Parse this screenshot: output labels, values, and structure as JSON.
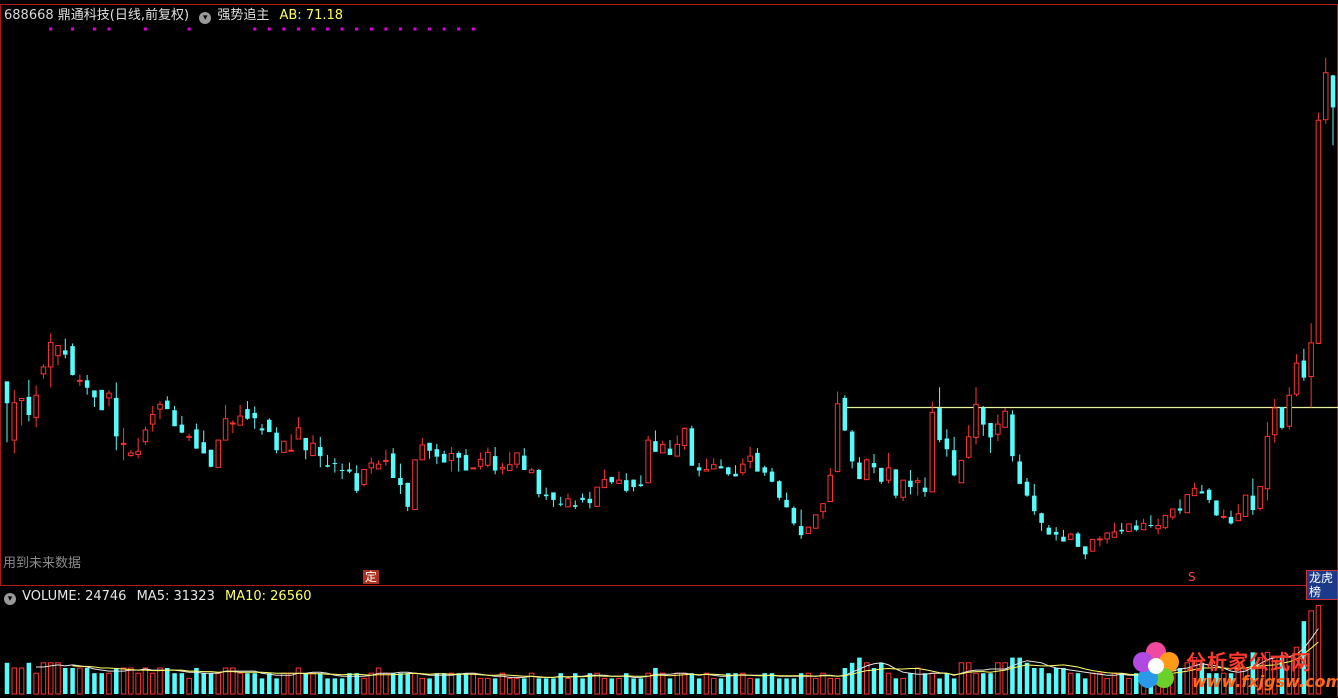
{
  "header": {
    "code": "688668",
    "name_line": "鼎通科技(日线,前复权)",
    "indicator": "强势追主",
    "ab_text": "AB: 71.18"
  },
  "volume_header": {
    "volume_text": "VOLUME: 24746",
    "ma5_text": "MA5: 31323",
    "ma10_text": "MA10: 26560"
  },
  "note": "用到未来数据",
  "tags": {
    "ding": "定",
    "s": "S",
    "lhb": "龙虎榜"
  },
  "watermark": {
    "cn": "分析家公式网",
    "url": "www.fxjgsw.com"
  },
  "colors": {
    "up": "#ff3232",
    "down": "#54fcfc",
    "signal": "#e000e0",
    "level_line": "#e8f0a0",
    "ma5": "#e6e6e6",
    "ma10": "#ffff66",
    "separator": "#b01818"
  },
  "chart_data": [
    {
      "type": "candlestick",
      "level_line_value": 67.3,
      "candles": [
        [
          72.2,
          68.1,
          72.2,
          60.8
        ],
        [
          61.2,
          68.2,
          70.6,
          58.7
        ],
        [
          68.6,
          69.0,
          69.1,
          63.9
        ],
        [
          69.3,
          65.9,
          72.5,
          64.7
        ],
        [
          65.4,
          69.6,
          71.4,
          63.6
        ],
        [
          73.6,
          74.9,
          75.4,
          72.7
        ],
        [
          74.9,
          79.5,
          81.2,
          71.1
        ],
        [
          77.0,
          78.9,
          78.6,
          75.2
        ],
        [
          78.0,
          77.2,
          80.2,
          76.5
        ],
        [
          78.8,
          73.4,
          79.3,
          73.3
        ],
        [
          72.3,
          72.4,
          73.5,
          71.3
        ],
        [
          72.4,
          71.0,
          73.4,
          69.7
        ],
        [
          70.5,
          69.2,
          70.1,
          67.4
        ],
        [
          70.6,
          66.8,
          70.2,
          68.2
        ],
        [
          69.1,
          70.0,
          70.5,
          67.5
        ],
        [
          69.1,
          61.9,
          72.0,
          59.3
        ],
        [
          60.4,
          60.6,
          63.5,
          57.4
        ],
        [
          58.3,
          58.8,
          59.3,
          58.1
        ],
        [
          58.5,
          59.1,
          61.6,
          57.8
        ],
        [
          60.9,
          63.1,
          63.7,
          60.3
        ],
        [
          64.2,
          66.0,
          67.6,
          62.8
        ],
        [
          67.0,
          67.9,
          68.5,
          65.1
        ],
        [
          68.6,
          67.0,
          69.4,
          67.0
        ],
        [
          66.8,
          63.8,
          67.6,
          65.2
        ],
        [
          64.1,
          62.6,
          65.7,
          62.5
        ],
        [
          61.8,
          61.9,
          62.4,
          61.0
        ],
        [
          63.2,
          59.6,
          64.3,
          60.6
        ],
        [
          60.8,
          58.7,
          63.0,
          59.6
        ],
        [
          59.4,
          56.2,
          58.4,
          56.1
        ],
        [
          56.1,
          61.2,
          60.4,
          56.1
        ],
        [
          61.2,
          65.2,
          67.8,
          61.3
        ],
        [
          64.3,
          64.4,
          64.9,
          62.5
        ],
        [
          64.0,
          65.7,
          67.8,
          65.2
        ],
        [
          67.0,
          65.2,
          68.5,
          65.0
        ],
        [
          66.3,
          65.3,
          67.5,
          63.3
        ],
        [
          63.4,
          63.0,
          64.2,
          62.2
        ],
        [
          65.0,
          62.7,
          65.3,
          62.9
        ],
        [
          62.6,
          59.3,
          63.6,
          58.7
        ],
        [
          58.9,
          61.0,
          60.5,
          59.1
        ],
        [
          59.2,
          59.3,
          62.3,
          59.2
        ],
        [
          61.4,
          63.5,
          65.5,
          61.8
        ],
        [
          61.6,
          59.3,
          61.3,
          57.6
        ],
        [
          58.3,
          60.6,
          62.1,
          58.3
        ],
        [
          59.9,
          58.2,
          61.8,
          56.1
        ],
        [
          56.5,
          56.2,
          58.4,
          56.1
        ],
        [
          56.9,
          56.8,
          57.8,
          55.1
        ],
        [
          55.6,
          55.5,
          56.8,
          53.9
        ],
        [
          55.7,
          55.3,
          57.0,
          55.0
        ],
        [
          55.0,
          51.7,
          56.5,
          51.3
        ],
        [
          52.9,
          55.7,
          55.1,
          52.5
        ],
        [
          56.0,
          56.9,
          57.9,
          54.9
        ],
        [
          55.8,
          56.7,
          57.4,
          55.7
        ],
        [
          57.4,
          57.4,
          59.4,
          56.4
        ],
        [
          58.7,
          54.1,
          59.7,
          54.7
        ],
        [
          54.1,
          52.8,
          56.8,
          51.1
        ],
        [
          53.2,
          48.7,
          52.3,
          47.9
        ],
        [
          48.2,
          57.5,
          56.5,
          50.5
        ],
        [
          57.5,
          60.3,
          61.6,
          57.5
        ],
        [
          60.7,
          59.2,
          60.3,
          57.7
        ],
        [
          59.5,
          58.1,
          60.5,
          56.7
        ],
        [
          58.6,
          57.0,
          59.2,
          57.7
        ],
        [
          57.4,
          58.7,
          59.9,
          55.3
        ],
        [
          58.8,
          57.9,
          59.1,
          55.3
        ],
        [
          58.4,
          55.5,
          59.5,
          55.7
        ],
        [
          56.0,
          56.0,
          56.0,
          56.0
        ],
        [
          56.3,
          57.6,
          58.9,
          55.7
        ],
        [
          56.5,
          58.9,
          59.8,
          56.1
        ],
        [
          58.2,
          55.5,
          59.9,
          54.8
        ],
        [
          55.8,
          56.1,
          56.9,
          54.8
        ],
        [
          55.5,
          56.6,
          59.0,
          55.6
        ],
        [
          56.7,
          58.8,
          57.7,
          55.9
        ],
        [
          58.3,
          55.6,
          59.7,
          55.6
        ],
        [
          55.1,
          55.6,
          56.0,
          55.4
        ],
        [
          55.6,
          51.1,
          55.8,
          50.5
        ],
        [
          51.0,
          50.7,
          52.3,
          50.0
        ],
        [
          51.4,
          50.0,
          51.1,
          48.7
        ],
        [
          49.3,
          49.1,
          50.6,
          48.8
        ],
        [
          48.7,
          50.2,
          51.2,
          48.7
        ],
        [
          49.0,
          48.7,
          49.9,
          48.3
        ],
        [
          50.4,
          50.0,
          51.2,
          49.5
        ],
        [
          50.2,
          49.4,
          51.5,
          48.4
        ],
        [
          48.8,
          52.4,
          52.3,
          48.7
        ],
        [
          52.3,
          53.8,
          55.7,
          52.4
        ],
        [
          54.3,
          53.3,
          54.1,
          53.0
        ],
        [
          53.1,
          53.7,
          55.3,
          53.4
        ],
        [
          53.7,
          51.7,
          55.0,
          51.4
        ],
        [
          53.8,
          52.4,
          53.7,
          51.6
        ],
        [
          52.9,
          52.6,
          54.6,
          52.4
        ],
        [
          53.2,
          61.2,
          62.0,
          53.1
        ],
        [
          61.0,
          59.0,
          63.0,
          60.6
        ],
        [
          58.8,
          60.4,
          61.1,
          59.0
        ],
        [
          59.6,
          58.4,
          61.2,
          59.1
        ],
        [
          58.2,
          60.4,
          62.1,
          58.1
        ],
        [
          60.2,
          63.4,
          63.6,
          59.4
        ],
        [
          63.4,
          56.4,
          63.9,
          56.6
        ],
        [
          56.1,
          55.5,
          56.9,
          54.4
        ],
        [
          55.4,
          55.7,
          57.7,
          55.7
        ],
        [
          55.8,
          56.6,
          57.8,
          56.0
        ],
        [
          56.3,
          55.9,
          57.6,
          55.9
        ],
        [
          56.1,
          54.8,
          56.2,
          54.5
        ],
        [
          54.9,
          54.4,
          56.5,
          54.4
        ],
        [
          55.1,
          56.7,
          57.8,
          54.6
        ],
        [
          57.2,
          58.2,
          59.9,
          55.9
        ],
        [
          58.8,
          55.3,
          59.7,
          55.6
        ],
        [
          56.1,
          55.1,
          56.4,
          54.5
        ],
        [
          55.3,
          53.4,
          56.0,
          53.3
        ],
        [
          53.5,
          50.4,
          53.7,
          49.9
        ],
        [
          50.0,
          48.6,
          51.4,
          48.6
        ],
        [
          48.5,
          45.6,
          48.8,
          45.2
        ],
        [
          45.1,
          43.4,
          48.2,
          42.7
        ],
        [
          43.7,
          44.9,
          44.7,
          43.8
        ],
        [
          44.7,
          47.2,
          46.6,
          44.6
        ],
        [
          47.8,
          49.3,
          48.1,
          46.5
        ],
        [
          49.7,
          54.6,
          56.0,
          49.9
        ],
        [
          55.3,
          68.0,
          70.3,
          57.6
        ],
        [
          69.1,
          63.0,
          69.6,
          62.9
        ],
        [
          62.8,
          57.2,
          63.1,
          55.9
        ],
        [
          57.0,
          53.9,
          58.0,
          54.2
        ],
        [
          53.8,
          57.5,
          57.8,
          54.7
        ],
        [
          56.9,
          56.1,
          58.6,
          55.0
        ],
        [
          56.0,
          53.4,
          55.9,
          53.0
        ],
        [
          53.7,
          56.0,
          58.8,
          53.1
        ],
        [
          55.7,
          50.8,
          55.8,
          50.3
        ],
        [
          50.5,
          53.7,
          53.3,
          49.8
        ],
        [
          53.6,
          52.4,
          55.6,
          51.0
        ],
        [
          53.3,
          53.6,
          54.2,
          50.8
        ],
        [
          52.3,
          51.5,
          54.2,
          50.6
        ],
        [
          51.5,
          66.4,
          68.4,
          52.6
        ],
        [
          67.2,
          61.2,
          71.1,
          60.8
        ],
        [
          61.5,
          59.5,
          63.2,
          58.1
        ],
        [
          59.3,
          54.6,
          61.8,
          54.4
        ],
        [
          53.2,
          57.4,
          57.5,
          53.4
        ],
        [
          58.0,
          61.8,
          64.0,
          57.7
        ],
        [
          61.7,
          67.9,
          71.1,
          60.4
        ],
        [
          67.3,
          64.1,
          67.6,
          62.0
        ],
        [
          64.4,
          61.7,
          64.0,
          58.8
        ],
        [
          62.3,
          64.2,
          66.0,
          61.0
        ],
        [
          63.6,
          66.6,
          67.2,
          63.8
        ],
        [
          66.0,
          58.2,
          66.8,
          57.2
        ],
        [
          57.2,
          53.0,
          58.5,
          53.0
        ],
        [
          53.4,
          50.8,
          54.1,
          50.6
        ],
        [
          50.8,
          47.9,
          53.0,
          47.2
        ],
        [
          47.5,
          45.7,
          47.6,
          44.2
        ],
        [
          44.8,
          43.5,
          45.3,
          43.9
        ],
        [
          44.0,
          43.5,
          44.9,
          42.4
        ],
        [
          43.1,
          42.2,
          44.4,
          43.2
        ],
        [
          42.6,
          43.6,
          43.8,
          43.2
        ],
        [
          43.7,
          41.2,
          44.0,
          41.6
        ],
        [
          41.3,
          39.8,
          41.2,
          38.9
        ],
        [
          40.4,
          42.6,
          42.2,
          40.3
        ],
        [
          42.7,
          42.7,
          43.2,
          41.3
        ],
        [
          42.7,
          43.8,
          44.0,
          41.8
        ],
        [
          43.0,
          44.0,
          45.7,
          43.2
        ],
        [
          44.4,
          44.1,
          45.7,
          43.6
        ],
        [
          44.1,
          45.5,
          45.6,
          45.0
        ],
        [
          45.2,
          44.4,
          46.2,
          44.1
        ],
        [
          44.4,
          45.6,
          46.5,
          44.5
        ],
        [
          45.3,
          45.2,
          47.1,
          44.8
        ],
        [
          44.6,
          45.2,
          46.5,
          43.6
        ],
        [
          44.8,
          47.1,
          47.0,
          44.5
        ],
        [
          46.8,
          48.3,
          48.2,
          46.3
        ],
        [
          48.4,
          48.0,
          50.1,
          47.4
        ],
        [
          47.6,
          51.0,
          50.8,
          47.9
        ],
        [
          50.8,
          52.1,
          53.2,
          51.4
        ],
        [
          51.6,
          51.2,
          52.8,
          51.2
        ],
        [
          51.9,
          50.0,
          52.2,
          49.4
        ],
        [
          49.9,
          47.1,
          49.6,
          47.0
        ],
        [
          46.8,
          46.9,
          48.2,
          46.4
        ],
        [
          46.8,
          45.6,
          48.0,
          45.4
        ],
        [
          46.1,
          47.4,
          49.2,
          46.4
        ],
        [
          46.9,
          50.9,
          49.8,
          47.5
        ],
        [
          50.8,
          48.1,
          54.0,
          47.2
        ],
        [
          48.4,
          52.5,
          51.6,
          48.0
        ],
        [
          52.1,
          61.9,
          64.6,
          49.9
        ],
        [
          62.2,
          67.2,
          68.9,
          60.7
        ],
        [
          67.4,
          63.5,
          67.3,
          63.2
        ],
        [
          63.8,
          69.6,
          71.1,
          63.2
        ],
        [
          69.8,
          75.6,
          77.3,
          69.4
        ],
        [
          76.1,
          72.9,
          78.3,
          72.3
        ],
        [
          73.1,
          79.4,
          83.1,
          67.3
        ],
        [
          79.3,
          121.1,
          122.5,
          80.6
        ],
        [
          121.2,
          130.0,
          132.8,
          120.4
        ],
        [
          129.5,
          123.5,
          129.6,
          116.4
        ]
      ],
      "volume": [
        6,
        5,
        5,
        6,
        4,
        6,
        6,
        6,
        5,
        5,
        5,
        5,
        4,
        4,
        4,
        5,
        5,
        5,
        4,
        5,
        4,
        5,
        5,
        4,
        4,
        3,
        5,
        4,
        4,
        4,
        5,
        5,
        4,
        4,
        4,
        3,
        4,
        3,
        4,
        4,
        5,
        4,
        4,
        4,
        3,
        3,
        3,
        4,
        4,
        3,
        4,
        5,
        4,
        4,
        4,
        4,
        4,
        3,
        3,
        4,
        4,
        4,
        4,
        4,
        4,
        3,
        3,
        3,
        4,
        3,
        3,
        3,
        4,
        3,
        3,
        3,
        4,
        3,
        4,
        3,
        4,
        4,
        3,
        3,
        3,
        4,
        3,
        3,
        4,
        5,
        4,
        3,
        4,
        4,
        4,
        3,
        4,
        3,
        3,
        4,
        4,
        4,
        3,
        3,
        4,
        4,
        3,
        3,
        3,
        4,
        4,
        3,
        4,
        3,
        3,
        5,
        6,
        7,
        6,
        5,
        6,
        4,
        3,
        3,
        4,
        5,
        4,
        4,
        3,
        4,
        3,
        6,
        6,
        4,
        4,
        4,
        6,
        6,
        7,
        7,
        6,
        5,
        5,
        4,
        5,
        5,
        4,
        4,
        3,
        4,
        4,
        3,
        4,
        4,
        3,
        4,
        3,
        5,
        5,
        4,
        5,
        5,
        6,
        7,
        6,
        4,
        4,
        4,
        4,
        5,
        5,
        8,
        7,
        8,
        7,
        7,
        7,
        9,
        14,
        16,
        17
      ],
      "signals": [
        [
          2
        ],
        [
          3
        ],
        [
          3
        ],
        [
          2
        ],
        [
          5
        ],
        [
          6
        ],
        [
          9
        ],
        [
          2
        ],
        [
          2
        ],
        [
          2
        ],
        [
          2
        ],
        [
          2
        ],
        [
          2
        ],
        [
          2
        ],
        [
          2
        ],
        [
          2
        ],
        [
          2
        ],
        [
          2
        ],
        [
          2
        ],
        [
          2
        ],
        [
          2
        ],
        [
          2
        ]
      ]
    }
  ]
}
